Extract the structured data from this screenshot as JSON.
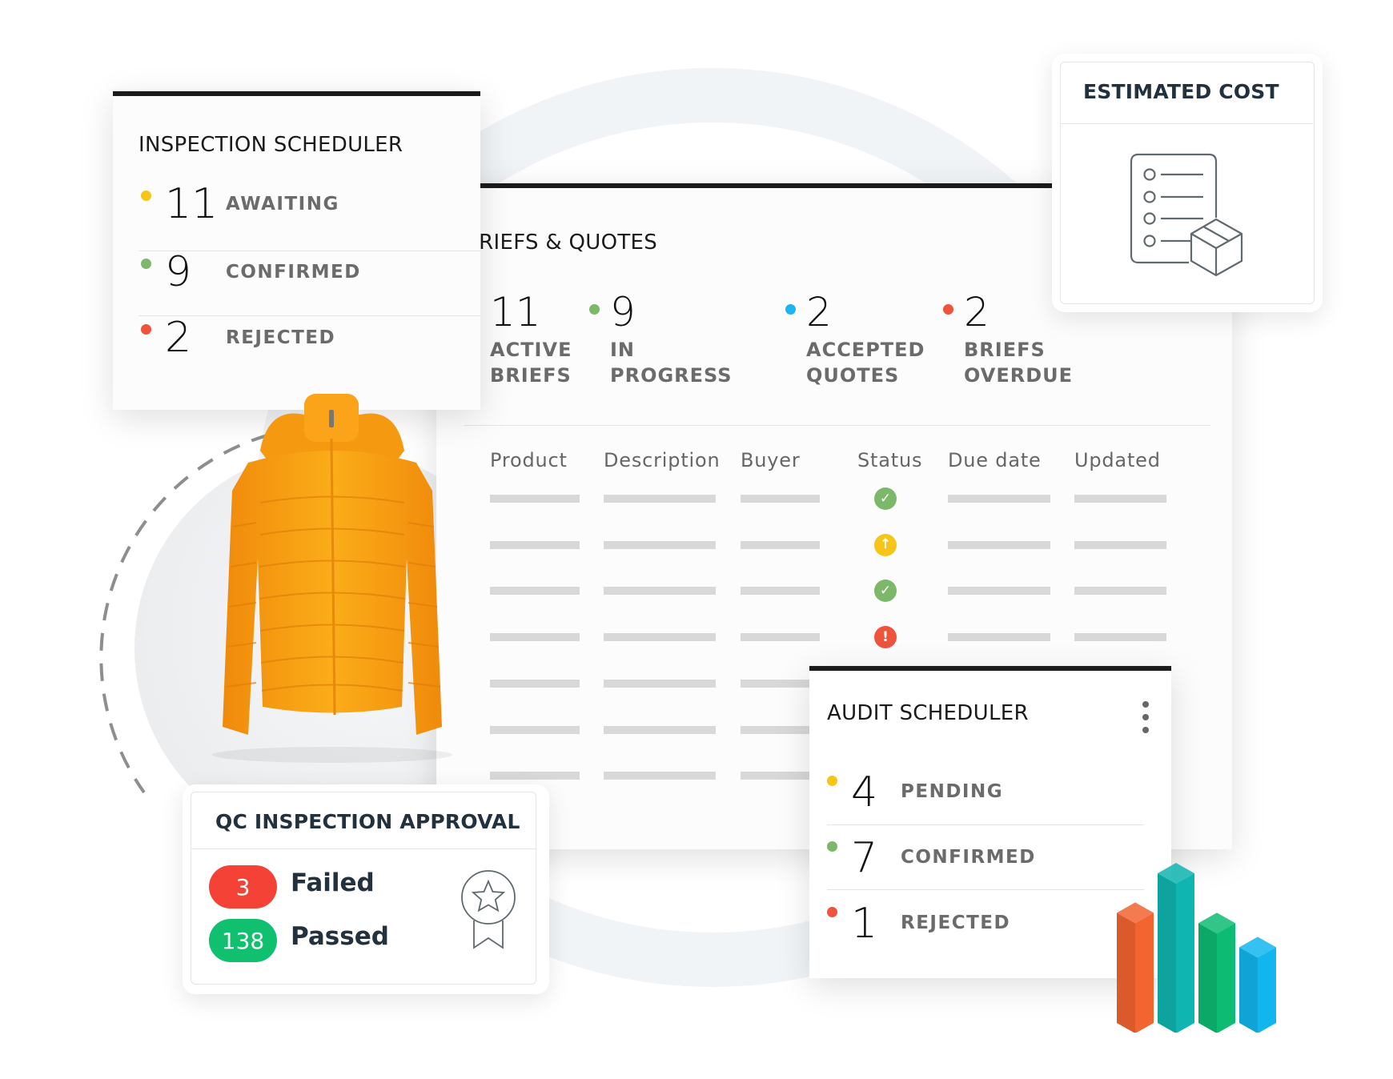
{
  "colors": {
    "yellow": "#f5c518",
    "green": "#7cb86a",
    "blue": "#1cb5f0",
    "red": "#f0533c",
    "failed_pill": "#f44336",
    "passed_pill": "#10c06e",
    "icon_stroke": "#606a6e"
  },
  "inspection_scheduler": {
    "title": "INSPECTION SCHEDULER",
    "rows": [
      {
        "value": "11",
        "label": "AWAITING",
        "status": "yellow"
      },
      {
        "value": "9",
        "label": "CONFIRMED",
        "status": "green"
      },
      {
        "value": "2",
        "label": "REJECTED",
        "status": "red"
      }
    ]
  },
  "briefs_quotes": {
    "title": "BRIEFS & QUOTES",
    "stats": [
      {
        "value": "11",
        "label": "ACTIVE\nBRIEFS",
        "status": "yellow"
      },
      {
        "value": "9",
        "label": "IN PROGRESS",
        "status": "green"
      },
      {
        "value": "2",
        "label": "ACCEPTED\nQUOTES",
        "status": "blue"
      },
      {
        "value": "2",
        "label": "BRIEFS\nOVERDUE",
        "status": "red"
      }
    ],
    "table": {
      "columns": [
        "Product",
        "Description",
        "Buyer",
        "Status",
        "Due date",
        "Updated"
      ],
      "row_statuses": [
        "approved",
        "in-progress",
        "approved",
        "overdue",
        "",
        "",
        ""
      ],
      "status_icons": {
        "approved": "check-circle-icon",
        "in-progress": "arrow-up-circle-icon",
        "overdue": "exclamation-circle-icon"
      }
    }
  },
  "estimated_cost": {
    "title": "ESTIMATED COST",
    "icon": "checklist-box-icon"
  },
  "qc_inspection_approval": {
    "title": "QC INSPECTION APPROVAL",
    "failed": {
      "count": "3",
      "label": "Failed"
    },
    "passed": {
      "count": "138",
      "label": "Passed"
    },
    "icon": "award-ribbon-icon"
  },
  "audit_scheduler": {
    "title": "AUDIT SCHEDULER",
    "menu_icon": "kebab-menu-icon",
    "rows": [
      {
        "value": "4",
        "label": "PENDING",
        "status": "yellow"
      },
      {
        "value": "7",
        "label": "CONFIRMED",
        "status": "green"
      },
      {
        "value": "1",
        "label": "REJECTED",
        "status": "red"
      }
    ]
  },
  "decoration": {
    "bar_chart_relative_heights": [
      0.64,
      0.87,
      0.58,
      0.44
    ],
    "bar_chart_colors": [
      "#f26430",
      "#0fb5b0",
      "#0dbb72",
      "#12b6ee"
    ],
    "product_image": "orange-puffer-jacket"
  }
}
